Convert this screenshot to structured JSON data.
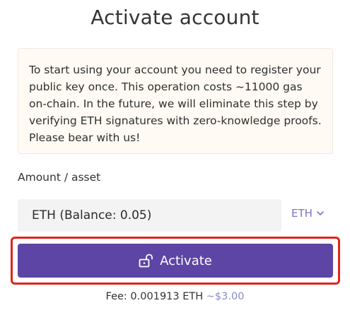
{
  "title": "Activate account",
  "notice": {
    "text": "To start using your account you need to register your public key once. This operation costs ~11000 gas on-chain. In the future, we will eliminate this step by verifying ETH signatures with zero-knowledge proofs. Please bear with us!"
  },
  "amount": {
    "label": "Amount / asset",
    "value": "ETH (Balance: 0.05)",
    "asset_selected": "ETH",
    "asset_icon": "chevron-down-icon"
  },
  "activate": {
    "label": "Activate",
    "icon": "unlock-icon",
    "highlight_color": "#e2231a",
    "button_color": "#5c45a4"
  },
  "fee": {
    "label": "Fee: 0.001913 ETH",
    "usd": "~$3.00"
  }
}
